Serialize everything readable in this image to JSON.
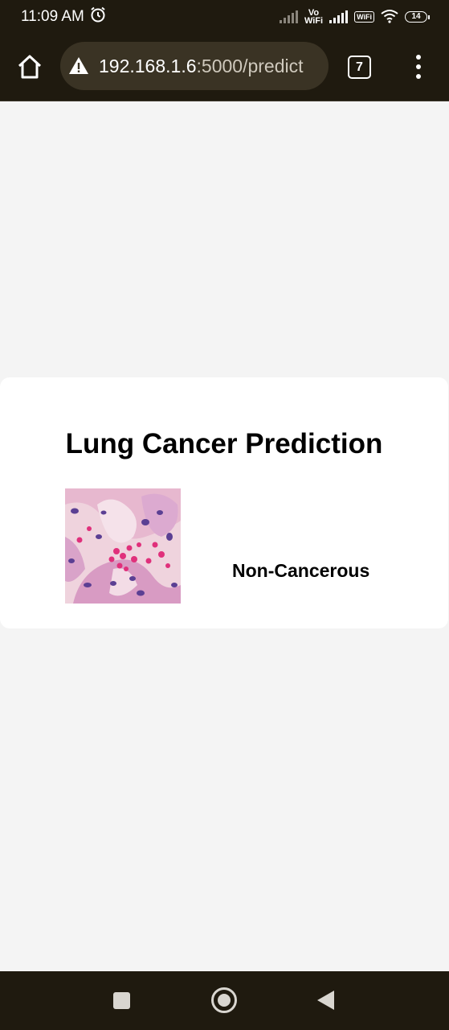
{
  "status_bar": {
    "time": "11:09 AM",
    "alarm_icon": "alarm-clock-icon",
    "vowifi_top": "Vo",
    "vowifi_bottom": "WiFi",
    "wifi_badge": "WiFi",
    "battery_level": "14"
  },
  "browser": {
    "url_host": "192.168.1.6",
    "url_path": ":5000/predict",
    "tab_count": "7",
    "security": "not-secure"
  },
  "card": {
    "title": "Lung Cancer Prediction",
    "result": "Non-Cancerous",
    "image_description": "histology-slide"
  },
  "nav": {
    "recent_icon": "square-icon",
    "home_icon": "circle-icon",
    "back_icon": "triangle-back-icon"
  }
}
